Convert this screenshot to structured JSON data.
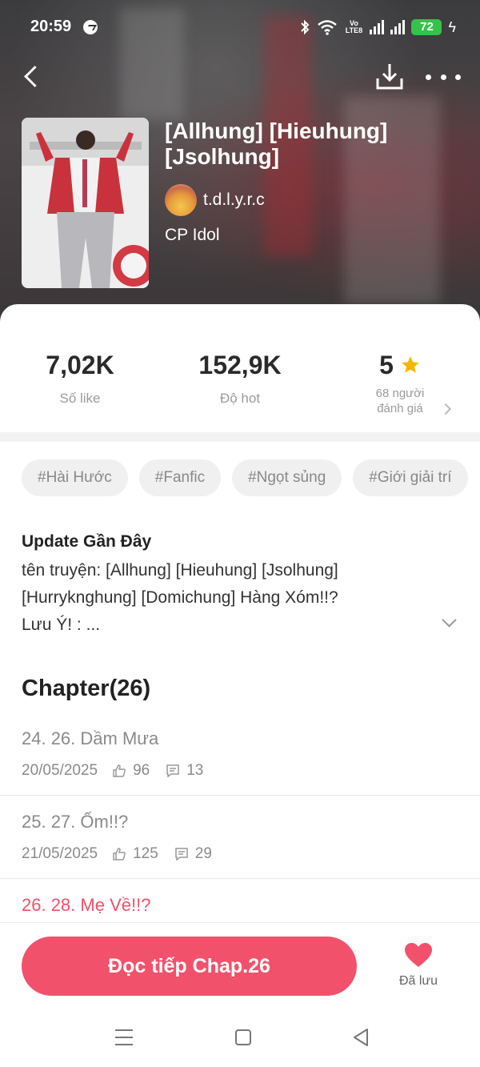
{
  "status_bar": {
    "time": "20:59",
    "network_label": "Vo LTE8",
    "battery": "72"
  },
  "book": {
    "title": "[Allhung] [Hieuhung] [Jsolhung] [Hurryknghung...",
    "author": "t.d.l.y.r.c",
    "category": "CP Idol"
  },
  "stats": {
    "likes_value": "7,02K",
    "likes_label": "Số like",
    "hot_value": "152,9K",
    "hot_label": "Độ hot",
    "rating_value": "5",
    "rating_count_line1": "68 người",
    "rating_count_line2": "đánh giá"
  },
  "tags": [
    "#Hài Hước",
    "#Fanfic",
    "#Ngọt sủng",
    "#Giới giải trí"
  ],
  "update": {
    "heading": "Update Gần Đây",
    "line1": "tên truyện: [Allhung] [Hieuhung] [Jsolhung]",
    "line2": "[Hurryknghung] [Domichung] Hàng Xóm!!?",
    "line3": "Lưu Ý! : ..."
  },
  "chapters": {
    "heading": "Chapter(26)",
    "items": [
      {
        "title": "24. 26. Dầm Mưa",
        "date": "20/05/2025",
        "likes": "96",
        "comments": "13"
      },
      {
        "title": "25. 27. Ốm!!?",
        "date": "21/05/2025",
        "likes": "125",
        "comments": "29"
      },
      {
        "title": "26. 28. Mẹ Về!!?"
      }
    ]
  },
  "actions": {
    "read_button": "Đọc tiếp Chap.26",
    "saved_label": "Đã lưu"
  },
  "colors": {
    "accent": "#f2516c",
    "current_chapter": "#f0516a",
    "star": "#f5b800",
    "battery": "#35c24a"
  }
}
